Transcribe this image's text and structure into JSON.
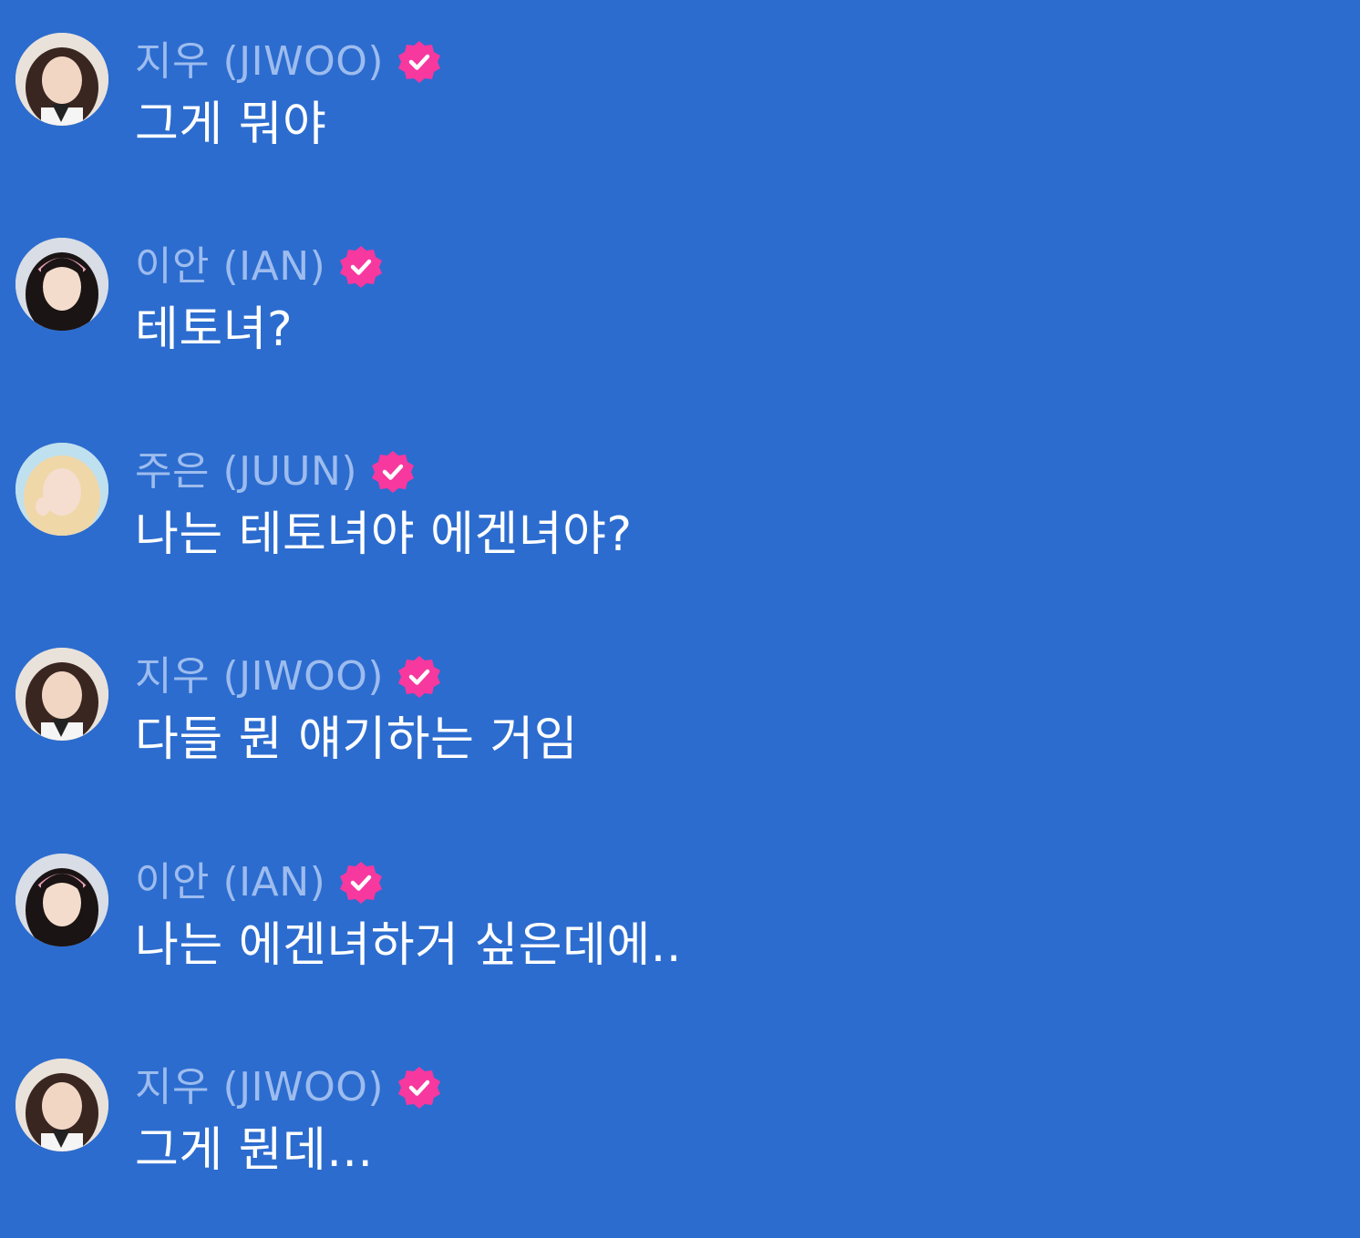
{
  "colors": {
    "background": "#2c6ccf",
    "name": "#9dbcee",
    "message": "#ffffff",
    "badge": "#f6389f"
  },
  "messages": [
    {
      "avatar_icon": "jiwoo-avatar",
      "name": "지우 (JIWOO)",
      "verified_icon": "verified-badge-icon",
      "text": "그게 뭐야"
    },
    {
      "avatar_icon": "ian-avatar",
      "name": "이안 (IAN)",
      "verified_icon": "verified-badge-icon",
      "text": "테토녀?"
    },
    {
      "avatar_icon": "juun-avatar",
      "name": "주은 (JUUN)",
      "verified_icon": "verified-badge-icon",
      "text": "나는 테토녀야 에겐녀야?"
    },
    {
      "avatar_icon": "jiwoo-avatar",
      "name": "지우 (JIWOO)",
      "verified_icon": "verified-badge-icon",
      "text": "다들 뭔 얘기하는 거임"
    },
    {
      "avatar_icon": "ian-avatar",
      "name": "이안 (IAN)",
      "verified_icon": "verified-badge-icon",
      "text": "나는 에겐녀하거 싶은데에.."
    },
    {
      "avatar_icon": "jiwoo-avatar",
      "name": "지우 (JIWOO)",
      "verified_icon": "verified-badge-icon",
      "text": "그게 뭔데..."
    }
  ]
}
